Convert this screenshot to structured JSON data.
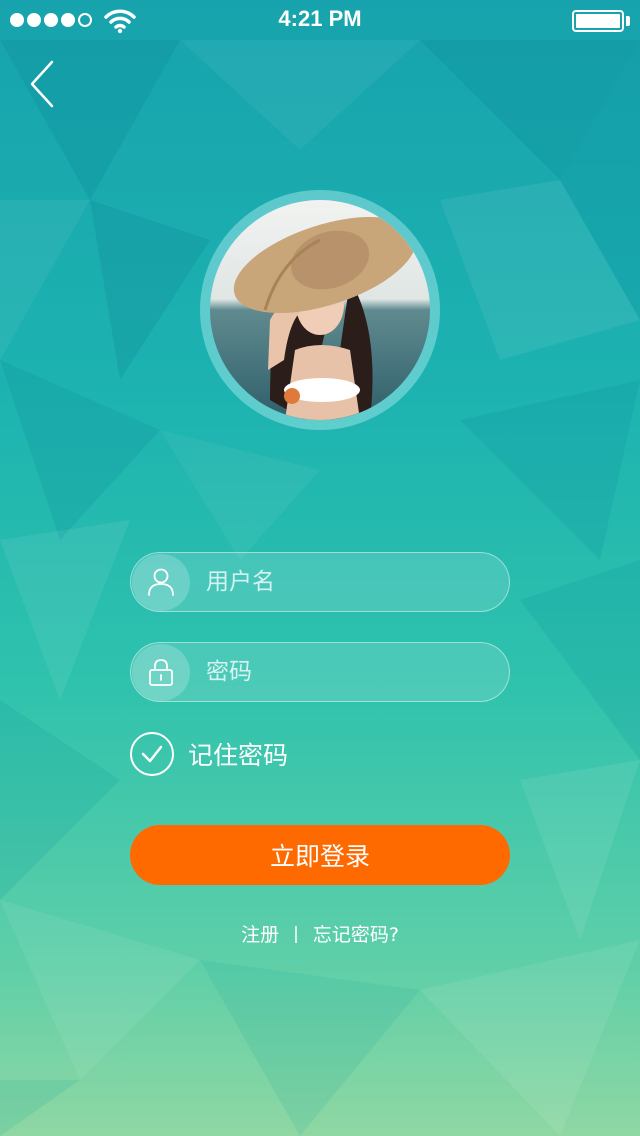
{
  "status_bar": {
    "time": "4:21 PM",
    "signal_dots_filled": 4,
    "signal_dots_total": 5,
    "battery_level": 1.0
  },
  "icons": {
    "back": "chevron-left-icon",
    "user": "user-icon",
    "lock": "lock-icon",
    "check": "check-circle-icon",
    "wifi": "wifi-icon",
    "battery": "battery-icon"
  },
  "login_form": {
    "username_placeholder": "用户名",
    "username_value": "",
    "password_placeholder": "密码",
    "password_value": "",
    "remember_label": "记住密码",
    "remember_checked": true,
    "submit_label": "立即登录"
  },
  "links": {
    "register": "注册",
    "separator": "|",
    "forgot": "忘记密码?"
  },
  "colors": {
    "background_top": "#17a3ad",
    "background_bottom": "#8fd7a3",
    "accent_button": "#ff6a00",
    "text": "#ffffff"
  }
}
